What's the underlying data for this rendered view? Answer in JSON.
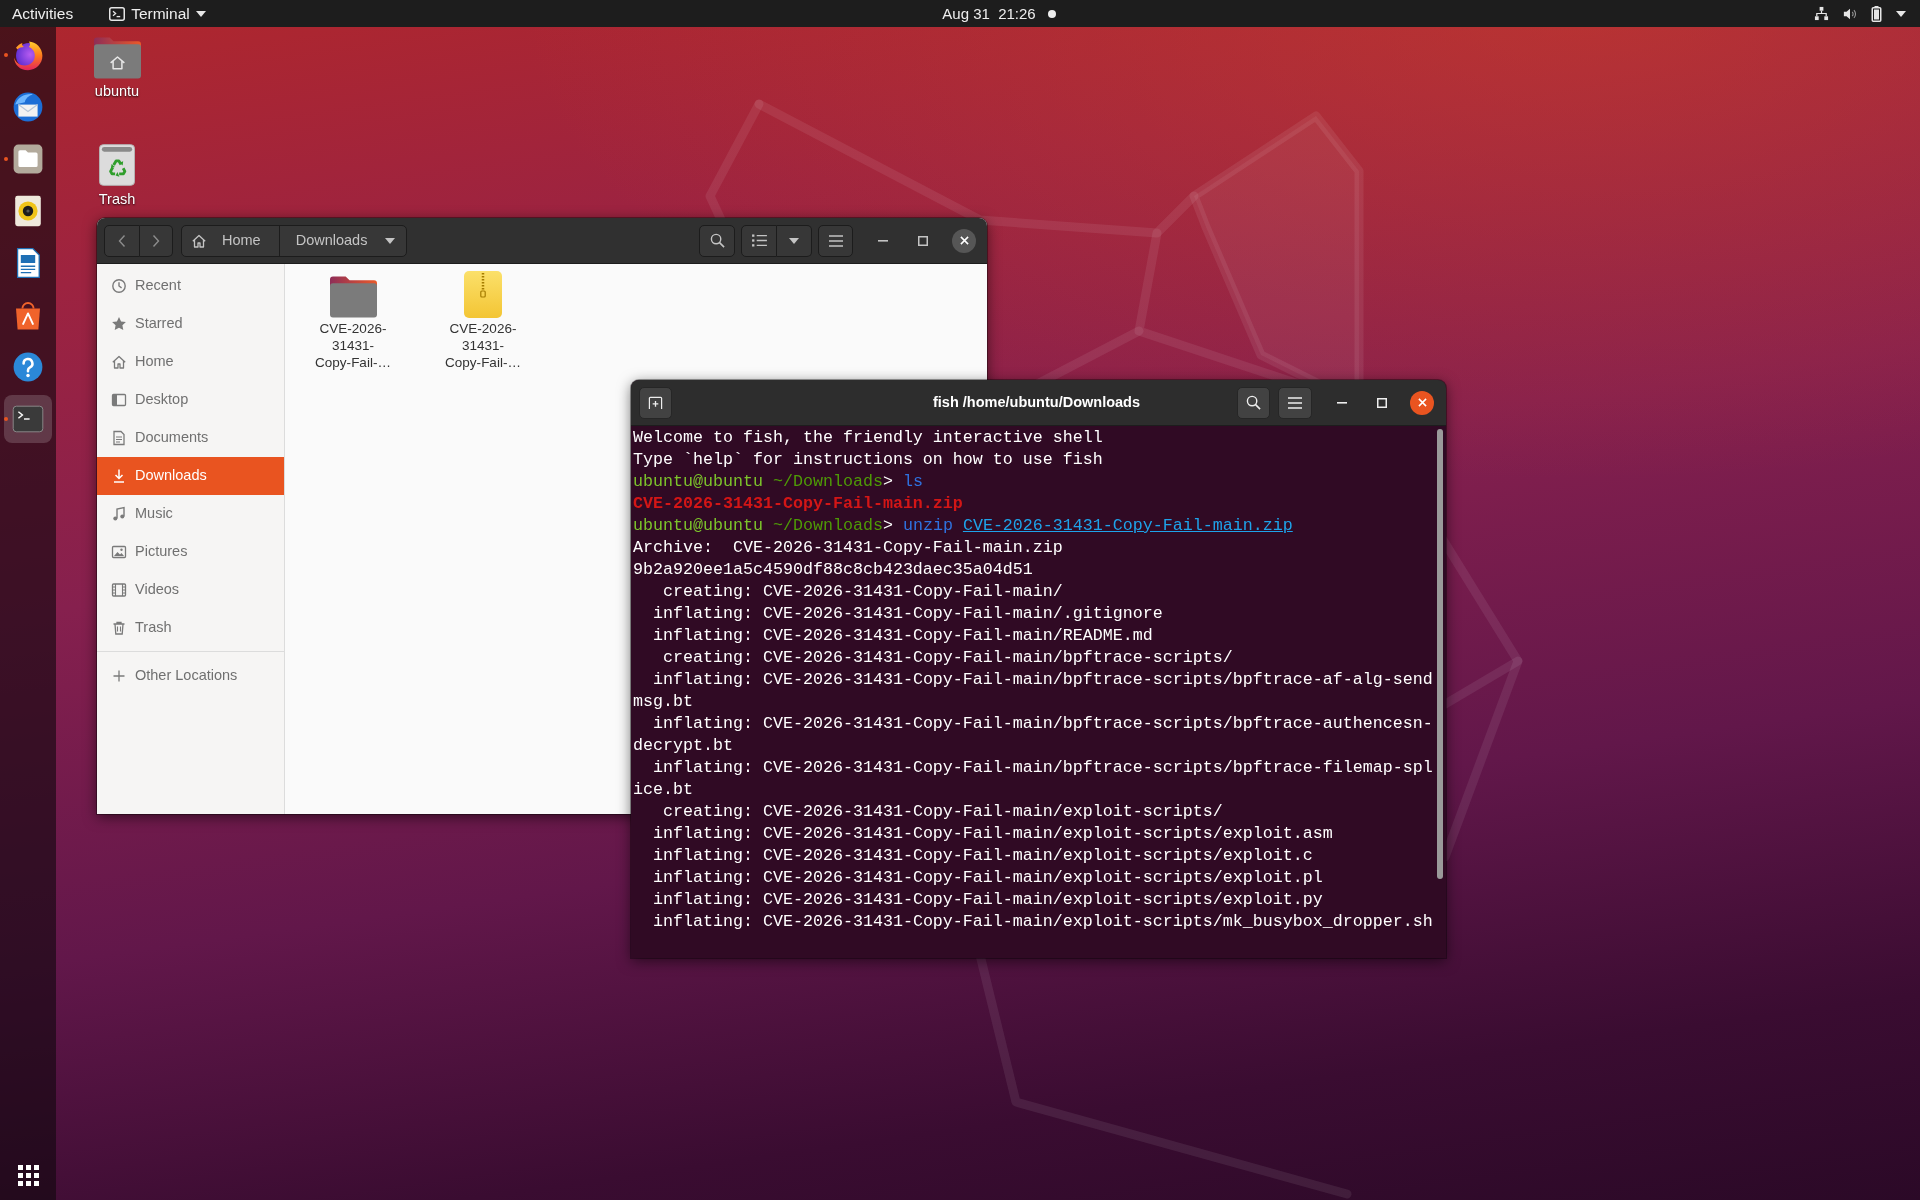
{
  "top_bar": {
    "activities": "Activities",
    "app_menu": "Terminal",
    "clock": "Aug 31  21:26",
    "notification_dot": true
  },
  "dock": {
    "items": [
      {
        "kind": "browser",
        "running": true,
        "focused": false
      },
      {
        "kind": "mail",
        "running": false,
        "focused": false
      },
      {
        "kind": "files",
        "running": true,
        "focused": false
      },
      {
        "kind": "music",
        "running": false,
        "focused": false
      },
      {
        "kind": "writer",
        "running": false,
        "focused": false
      },
      {
        "kind": "software",
        "running": false,
        "focused": false
      },
      {
        "kind": "help",
        "running": false,
        "focused": false
      },
      {
        "kind": "terminal",
        "running": true,
        "focused": true
      }
    ]
  },
  "desktop_icons": [
    {
      "kind": "home",
      "label": "ubuntu"
    },
    {
      "kind": "trash",
      "label": "Trash"
    }
  ],
  "files_window": {
    "path": [
      {
        "kind": "home",
        "label": "Home",
        "selected": false
      },
      {
        "kind": "folder",
        "label": "Downloads",
        "selected": true
      }
    ],
    "sidebar": {
      "items": [
        {
          "kind": "recent",
          "label": "Recent",
          "selected": false
        },
        {
          "kind": "starred",
          "label": "Starred",
          "selected": false
        },
        {
          "kind": "home",
          "label": "Home",
          "selected": false
        },
        {
          "kind": "desktop",
          "label": "Desktop",
          "selected": false
        },
        {
          "kind": "documents",
          "label": "Documents",
          "selected": false
        },
        {
          "kind": "downloads",
          "label": "Downloads",
          "selected": true
        },
        {
          "kind": "music",
          "label": "Music",
          "selected": false
        },
        {
          "kind": "pictures",
          "label": "Pictures",
          "selected": false
        },
        {
          "kind": "videos",
          "label": "Videos",
          "selected": false
        },
        {
          "kind": "trash",
          "label": "Trash",
          "selected": false
        }
      ],
      "footer_items": [
        {
          "kind": "other-locations",
          "label": "Other Locations",
          "selected": false
        }
      ]
    },
    "items": [
      {
        "kind": "folder",
        "name": "CVE-2026-31431-Copy-Fail-…"
      },
      {
        "kind": "archive",
        "name": "CVE-2026-31431-Copy-Fail-…"
      }
    ]
  },
  "terminal_window": {
    "title": "fish /home/ubuntu/Downloads",
    "lines": [
      {
        "kind": "text",
        "text": "Welcome to fish, the friendly interactive shell"
      },
      {
        "kind": "text",
        "text": "Type `help` for instructions on how to use fish"
      },
      {
        "kind": "prompt",
        "user": "ubuntu@ubuntu",
        "cwd": "~/Downloads",
        "symbol": ">",
        "command": "ls"
      },
      {
        "kind": "archive",
        "text": "CVE-2026-31431-Copy-Fail-main.zip"
      },
      {
        "kind": "prompt",
        "user": "ubuntu@ubuntu",
        "cwd": "~/Downloads",
        "symbol": ">",
        "command": "unzip",
        "argument": "CVE-2026-31431-Copy-Fail-main.zip"
      },
      {
        "kind": "text",
        "text": "Archive:  CVE-2026-31431-Copy-Fail-main.zip"
      },
      {
        "kind": "text",
        "text": "9b2a920ee1a5c4590df88c8cb423daec35a04d51"
      },
      {
        "kind": "text",
        "text": "   creating: CVE-2026-31431-Copy-Fail-main/"
      },
      {
        "kind": "text",
        "text": "  inflating: CVE-2026-31431-Copy-Fail-main/.gitignore"
      },
      {
        "kind": "text",
        "text": "  inflating: CVE-2026-31431-Copy-Fail-main/README.md"
      },
      {
        "kind": "text",
        "text": "   creating: CVE-2026-31431-Copy-Fail-main/bpftrace-scripts/"
      },
      {
        "kind": "text",
        "text": "  inflating: CVE-2026-31431-Copy-Fail-main/bpftrace-scripts/bpftrace-af-alg-sendmsg.bt"
      },
      {
        "kind": "text",
        "text": "  inflating: CVE-2026-31431-Copy-Fail-main/bpftrace-scripts/bpftrace-authencesn-decrypt.bt"
      },
      {
        "kind": "text",
        "text": "  inflating: CVE-2026-31431-Copy-Fail-main/bpftrace-scripts/bpftrace-filemap-splice.bt"
      },
      {
        "kind": "text",
        "text": "   creating: CVE-2026-31431-Copy-Fail-main/exploit-scripts/"
      },
      {
        "kind": "text",
        "text": "  inflating: CVE-2026-31431-Copy-Fail-main/exploit-scripts/exploit.asm"
      },
      {
        "kind": "text",
        "text": "  inflating: CVE-2026-31431-Copy-Fail-main/exploit-scripts/exploit.c"
      },
      {
        "kind": "text",
        "text": "  inflating: CVE-2026-31431-Copy-Fail-main/exploit-scripts/exploit.pl"
      },
      {
        "kind": "text",
        "text": "  inflating: CVE-2026-31431-Copy-Fail-main/exploit-scripts/exploit.py"
      },
      {
        "kind": "text",
        "text": "  inflating: CVE-2026-31431-Copy-Fail-main/exploit-scripts/mk_busybox_dropper.sh"
      }
    ]
  }
}
